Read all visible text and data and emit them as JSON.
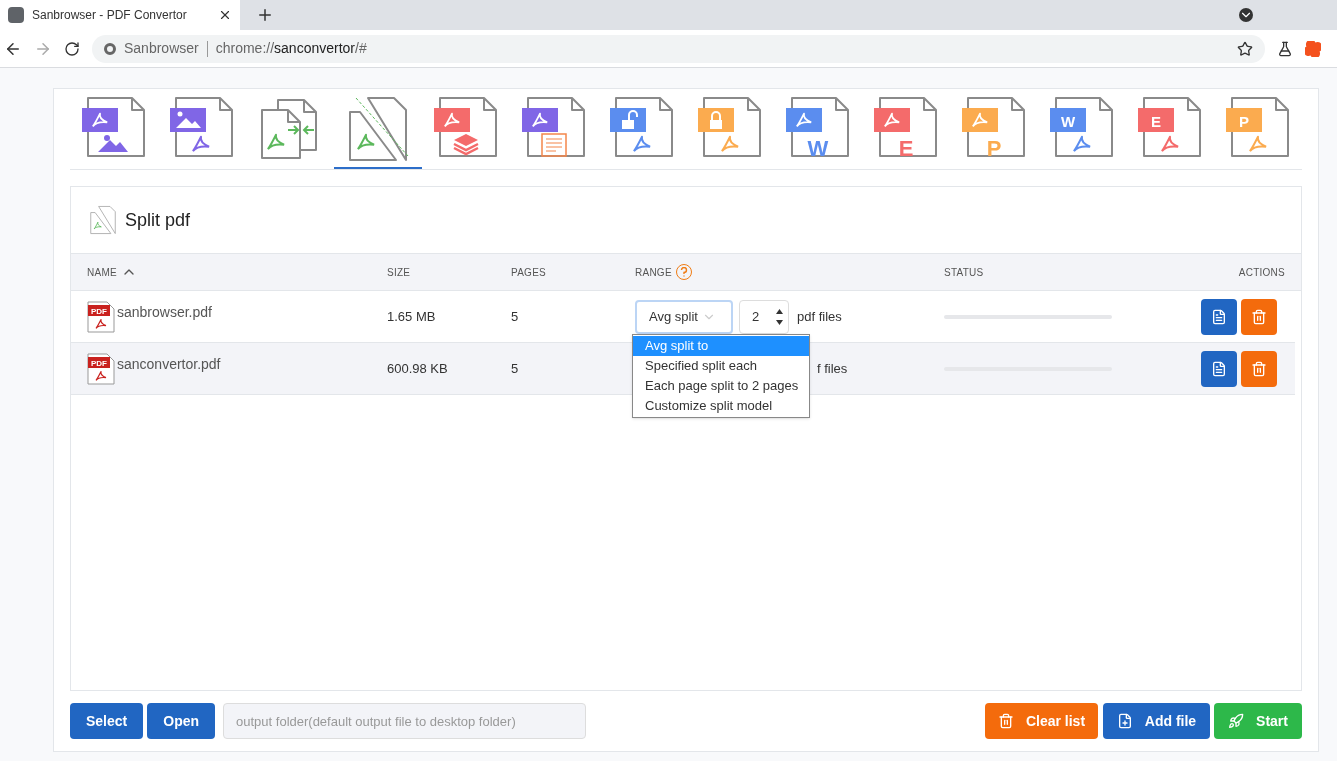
{
  "browser": {
    "tab_title": "Sanbrowser - PDF Convertor",
    "site": "Sanbrowser",
    "url": {
      "scheme": "chrome://",
      "host": "sanconvertor",
      "path": "/#"
    }
  },
  "tools": [
    {
      "kind": "pdf-to-image",
      "selected": false
    },
    {
      "kind": "image-to-pdf",
      "selected": false
    },
    {
      "kind": "merge",
      "selected": false
    },
    {
      "kind": "split",
      "selected": true
    },
    {
      "kind": "compress",
      "selected": false
    },
    {
      "kind": "pdf-to-text",
      "selected": false
    },
    {
      "kind": "unlock",
      "selected": false
    },
    {
      "kind": "lock",
      "selected": false
    },
    {
      "kind": "pdf-to-letter",
      "selected": false,
      "letter": "W",
      "color": "#5b8def"
    },
    {
      "kind": "pdf-to-letter",
      "selected": false,
      "letter": "E",
      "color": "#f46b6b"
    },
    {
      "kind": "pdf-to-letter",
      "selected": false,
      "letter": "P",
      "color": "#fbab4f"
    },
    {
      "kind": "letter-to-pdf",
      "selected": false,
      "letter": "W",
      "color": "#5b8def"
    },
    {
      "kind": "letter-to-pdf",
      "selected": false,
      "letter": "E",
      "color": "#f46b6b"
    },
    {
      "kind": "letter-to-pdf",
      "selected": false,
      "letter": "P",
      "color": "#fbab4f"
    }
  ],
  "panel": {
    "title": "Split pdf",
    "columns": [
      {
        "label": "NAME",
        "sort_ascending": true
      },
      {
        "label": "SIZE"
      },
      {
        "label": "PAGES"
      },
      {
        "label": "RANGE",
        "help": true
      },
      {
        "label": "STATUS"
      },
      {
        "label": "ACTIONS"
      }
    ],
    "rows": [
      {
        "badge": "PDF",
        "name": "sanbrowser.pdf",
        "size": "1.65 MB",
        "pages": "5",
        "range": {
          "mode": "Avg split",
          "count": "2",
          "suffix": "pdf files"
        },
        "level": 0
      },
      {
        "badge": "PDF",
        "name": "sanconvertor.pdf",
        "size": "600.98 KB",
        "pages": "5",
        "range": {
          "suffix": "f files"
        },
        "level": 0
      }
    ],
    "dropdown": [
      {
        "label": "Avg split to",
        "selected": true
      },
      {
        "label": "Specified split each",
        "selected": false
      },
      {
        "label": "Each page split to 2 pages",
        "selected": false
      },
      {
        "label": "Customize split model",
        "selected": false
      }
    ]
  },
  "footer": {
    "select": "Select",
    "open": "Open",
    "output_placeholder": "output folder(default output file to desktop folder)",
    "clear": "Clear list",
    "add": "Add file",
    "start": "Start"
  }
}
